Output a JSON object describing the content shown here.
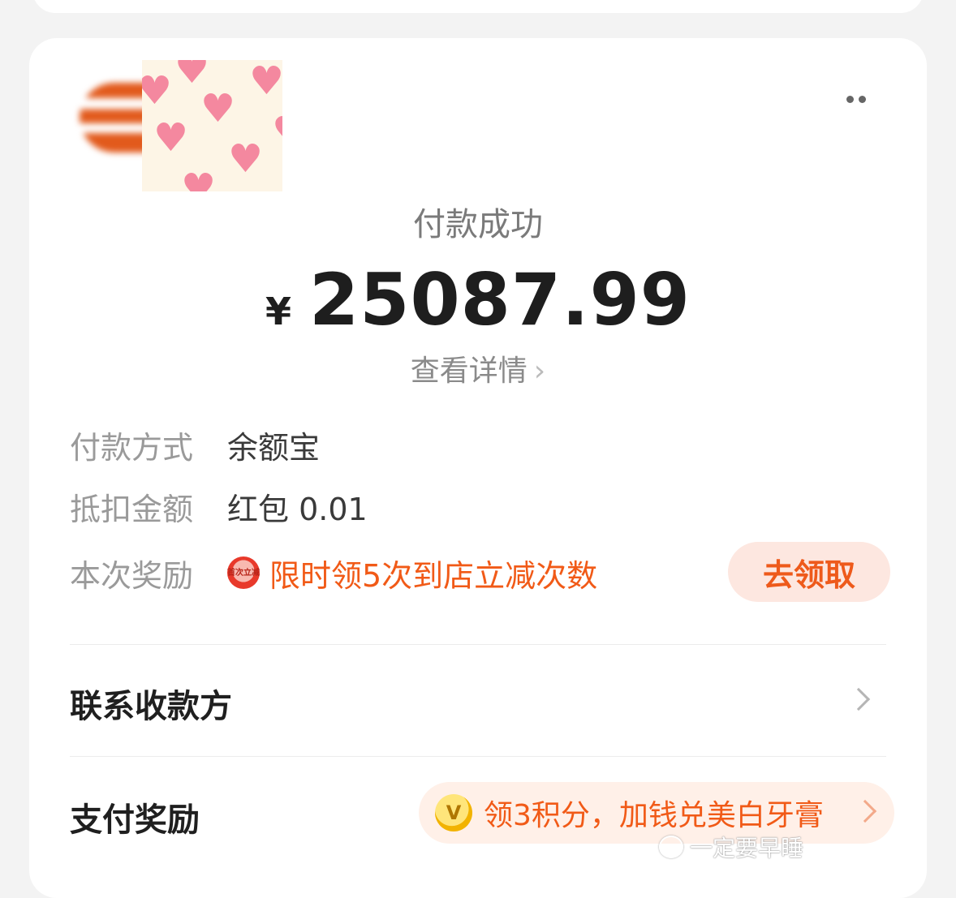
{
  "payment": {
    "status": "付款成功",
    "currency_symbol": "¥",
    "amount": "25087.99",
    "details_link": "查看详情"
  },
  "info": {
    "method": {
      "label": "付款方式",
      "value": "余额宝"
    },
    "deduction": {
      "label": "抵扣金额",
      "value": "红包 0.01"
    },
    "reward": {
      "label": "本次奖励",
      "icon_text": "首次立减",
      "text": "限时领5次到店立减次数",
      "button": "去领取"
    }
  },
  "contact_payee": {
    "label": "联系收款方"
  },
  "pay_reward": {
    "label": "支付奖励",
    "coin_glyph": "V",
    "promo_text": "领3积分，加钱兑美白牙膏"
  },
  "watermark": {
    "text": "一定要早睡"
  },
  "colors": {
    "accent": "#f15a17",
    "accent_bg": "#fde7e0",
    "background": "#f3f3f3",
    "card": "#ffffff"
  }
}
